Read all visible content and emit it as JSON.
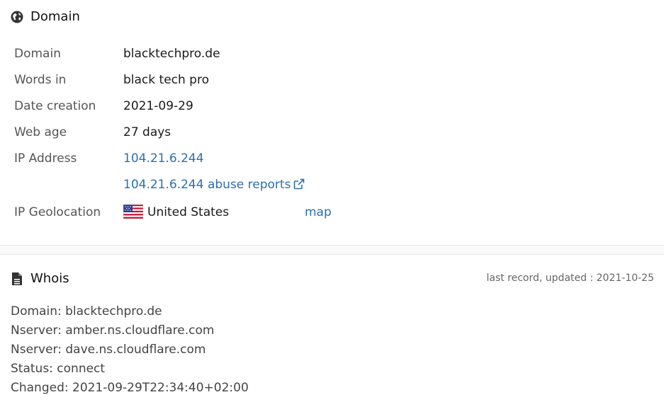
{
  "domain_section": {
    "title": "Domain",
    "icon": "globe-icon",
    "rows": {
      "domain": {
        "label": "Domain",
        "value": "blacktechpro.de"
      },
      "words": {
        "label": "Words in",
        "value": "black tech pro"
      },
      "date_creation": {
        "label": "Date creation",
        "value": "2021-09-29"
      },
      "web_age": {
        "label": "Web age",
        "value": "27 days"
      },
      "ip_address": {
        "label": "IP Address",
        "value": "104.21.6.244"
      },
      "abuse_reports": {
        "label": "",
        "value": "104.21.6.244 abuse reports"
      },
      "geolocation": {
        "label": "IP Geolocation",
        "value": "United States",
        "map_label": "map",
        "flag": "us-flag-icon"
      }
    },
    "link_color": "#2a6fb0"
  },
  "whois_section": {
    "title": "Whois",
    "icon": "document-icon",
    "meta": "last record, updated : 2021-10-25",
    "lines": [
      "Domain: blacktechpro.de",
      "Nserver: amber.ns.cloudflare.com",
      "Nserver: dave.ns.cloudflare.com",
      "Status: connect",
      "Changed: 2021-09-29T22:34:40+02:00"
    ]
  }
}
